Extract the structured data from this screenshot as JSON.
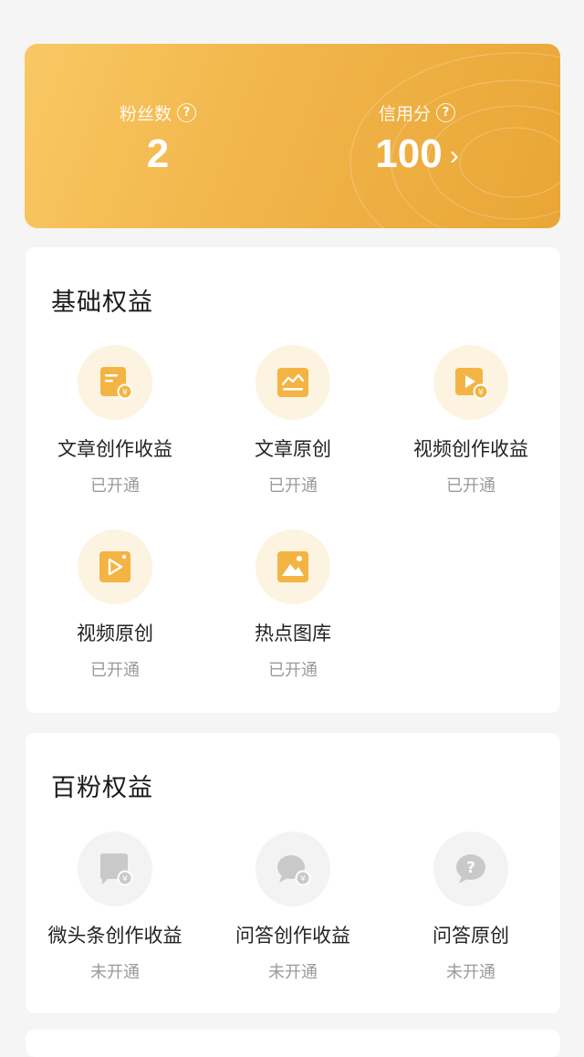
{
  "stats": {
    "fans": {
      "label": "粉丝数",
      "value": "2",
      "help_icon": "question-circle-icon"
    },
    "credit": {
      "label": "信用分",
      "value": "100",
      "help_icon": "question-circle-icon",
      "arrow": "›"
    }
  },
  "sections": {
    "basic": {
      "title": "基础权益",
      "items": [
        {
          "title": "文章创作收益",
          "status": "已开通",
          "icon": "article-revenue-icon"
        },
        {
          "title": "文章原创",
          "status": "已开通",
          "icon": "article-original-icon"
        },
        {
          "title": "视频创作收益",
          "status": "已开通",
          "icon": "video-revenue-icon"
        },
        {
          "title": "视频原创",
          "status": "已开通",
          "icon": "video-original-icon"
        },
        {
          "title": "热点图库",
          "status": "已开通",
          "icon": "hot-image-library-icon"
        }
      ]
    },
    "hundred": {
      "title": "百粉权益",
      "items": [
        {
          "title": "微头条创作收益",
          "status": "未开通",
          "icon": "micro-headline-revenue-icon"
        },
        {
          "title": "问答创作收益",
          "status": "未开通",
          "icon": "qa-revenue-icon"
        },
        {
          "title": "问答原创",
          "status": "未开通",
          "icon": "qa-original-icon"
        }
      ]
    }
  },
  "colors": {
    "accent_gold": "#f1b54a",
    "icon_gold": "#f3b443",
    "icon_bg_gold": "#fdf3e1",
    "icon_grey": "#c9c9c9",
    "status_text": "#9a9a9a"
  }
}
